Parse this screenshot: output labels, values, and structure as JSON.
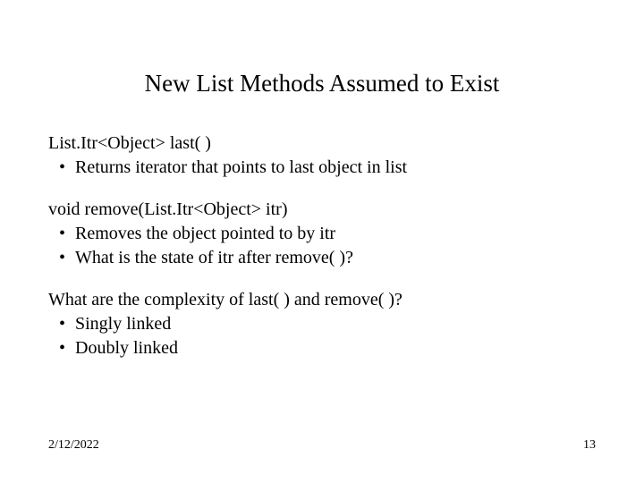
{
  "title": "New List Methods Assumed to Exist",
  "sections": [
    {
      "lead": "List.Itr<Object> last( )",
      "bullets": [
        "Returns iterator that points to last object in list"
      ]
    },
    {
      "lead": "void remove(List.Itr<Object> itr)",
      "bullets": [
        "Removes the object pointed to by itr",
        "What is the state of itr after remove( )?"
      ]
    },
    {
      "lead": "What are the complexity of last( ) and remove( )?",
      "bullets": [
        "Singly linked",
        "Doubly linked"
      ]
    }
  ],
  "footer": {
    "date": "2/12/2022",
    "page": "13"
  }
}
